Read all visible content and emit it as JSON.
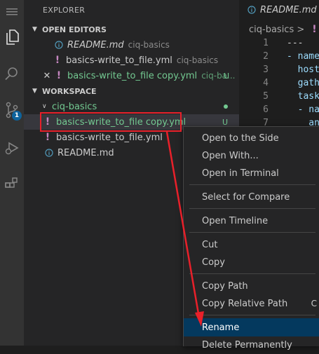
{
  "sidebar": {
    "title": "EXPLORER",
    "open_editors": {
      "header": "OPEN EDITORS",
      "items": [
        {
          "name": "README.md",
          "desc": "ciq-basics",
          "icon": "info-icon"
        },
        {
          "name": "basics-write_to_file.yml",
          "desc": "ciq-basics",
          "icon": "yaml-exclamation-icon"
        },
        {
          "name": "basics-write_to_file copy.yml",
          "desc": "ciq-ba...",
          "status": "U",
          "icon": "yaml-exclamation-icon"
        }
      ]
    },
    "workspace": {
      "header": "WORKSPACE",
      "folder": "ciq-basics",
      "items": [
        {
          "name": "basics-write_to_file copy.yml",
          "status": "U",
          "icon": "yaml-exclamation-icon"
        },
        {
          "name": "basics-write_to_file.yml",
          "icon": "yaml-exclamation-icon"
        },
        {
          "name": "README.md",
          "icon": "info-icon"
        }
      ]
    }
  },
  "activity_bar": {
    "icons": [
      "menu-icon",
      "files-icon",
      "search-icon",
      "source-control-icon",
      "run-debug-icon",
      "extensions-icon"
    ],
    "source_control_badge": "1"
  },
  "editor": {
    "tab_label": "README.md",
    "breadcrumb": "ciq-basics >",
    "lines": [
      {
        "n": "1",
        "text": "---"
      },
      {
        "n": "2",
        "text": "- name"
      },
      {
        "n": "3",
        "text": "  host"
      },
      {
        "n": "4",
        "text": "  gath"
      },
      {
        "n": "5",
        "text": "  task"
      },
      {
        "n": "6",
        "text": "  - na"
      },
      {
        "n": "7",
        "text": "    an"
      }
    ]
  },
  "context_menu": {
    "groups": [
      [
        {
          "label": "Open to the Side"
        },
        {
          "label": "Open With..."
        },
        {
          "label": "Open in Terminal"
        }
      ],
      [
        {
          "label": "Select for Compare"
        }
      ],
      [
        {
          "label": "Open Timeline"
        }
      ],
      [
        {
          "label": "Cut"
        },
        {
          "label": "Copy"
        }
      ],
      [
        {
          "label": "Copy Path"
        },
        {
          "label": "Copy Relative Path",
          "shortcut": "C"
        }
      ],
      [
        {
          "label": "Rename"
        },
        {
          "label": "Delete Permanently"
        }
      ]
    ],
    "active_item": "Rename"
  },
  "colors": {
    "annotation": "#e8202a",
    "git_untracked": "#73c991",
    "yaml_icon": "#c586c0",
    "menu_highlight": "#04395e"
  }
}
